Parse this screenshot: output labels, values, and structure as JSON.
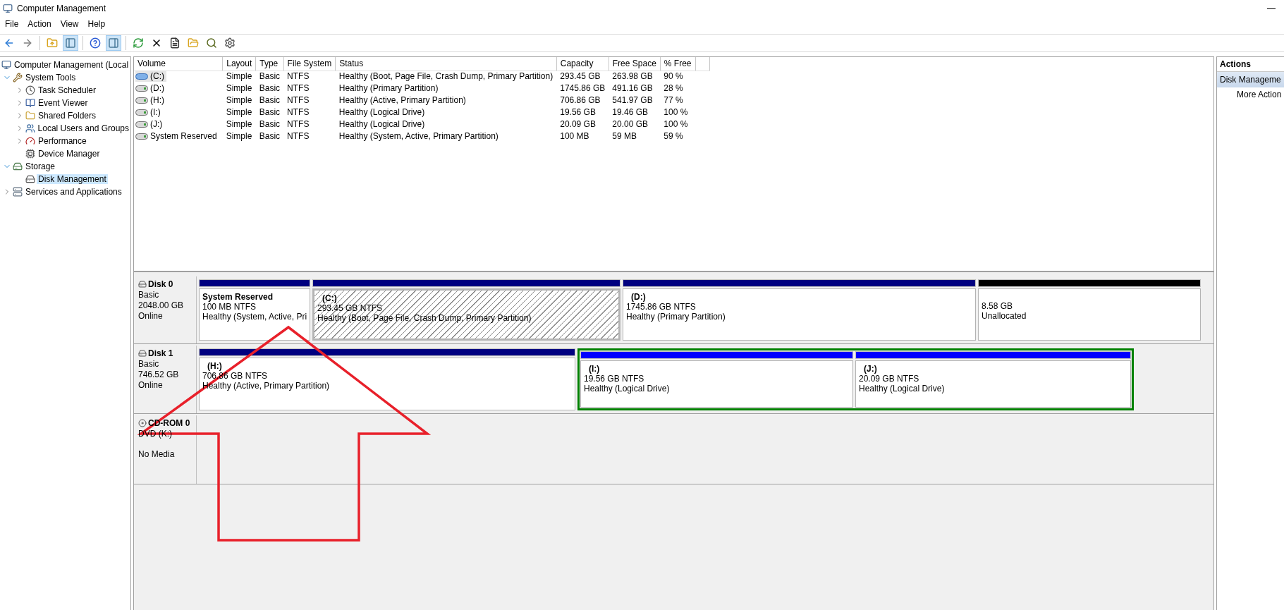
{
  "window": {
    "title": "Computer Management"
  },
  "menu": [
    "File",
    "Action",
    "View",
    "Help"
  ],
  "toolbar": [
    {
      "kind": "back",
      "pressed": false
    },
    {
      "kind": "forward",
      "pressed": false
    },
    {
      "kind": "sep"
    },
    {
      "kind": "up",
      "pressed": false
    },
    {
      "kind": "tree",
      "pressed": true
    },
    {
      "kind": "sep"
    },
    {
      "kind": "help",
      "pressed": false
    },
    {
      "kind": "pane",
      "pressed": true
    },
    {
      "kind": "sep"
    },
    {
      "kind": "refresh",
      "pressed": false
    },
    {
      "kind": "delete",
      "pressed": false
    },
    {
      "kind": "properties",
      "pressed": false
    },
    {
      "kind": "open",
      "pressed": false
    },
    {
      "kind": "find",
      "pressed": false
    },
    {
      "kind": "wizard",
      "pressed": false
    }
  ],
  "tree": [
    {
      "label": "Computer Management (Local",
      "selected": false,
      "children": [
        {
          "label": "System Tools",
          "expanded": true,
          "selected": false,
          "children": [
            {
              "label": "Task Scheduler",
              "expanded": false,
              "selected": false
            },
            {
              "label": "Event Viewer",
              "expanded": false,
              "selected": false
            },
            {
              "label": "Shared Folders",
              "expanded": false,
              "selected": false
            },
            {
              "label": "Local Users and Groups",
              "expanded": false,
              "selected": false
            },
            {
              "label": "Performance",
              "expanded": false,
              "selected": false
            },
            {
              "label": "Device Manager",
              "selected": false
            }
          ]
        },
        {
          "label": "Storage",
          "expanded": true,
          "selected": false,
          "children": [
            {
              "label": "Disk Management",
              "selected": true
            }
          ]
        },
        {
          "label": "Services and Applications",
          "expanded": false,
          "selected": false
        }
      ]
    }
  ],
  "table": {
    "columns": [
      "Volume",
      "Layout",
      "Type",
      "File System",
      "Status",
      "Capacity",
      "Free Space",
      "% Free"
    ],
    "rows": [
      {
        "volume": "(C:)",
        "boot": true,
        "selected": true,
        "layout": "Simple",
        "type": "Basic",
        "fs": "NTFS",
        "status": "Healthy (Boot, Page File, Crash Dump, Primary Partition)",
        "capacity": "293.45 GB",
        "free": "263.98 GB",
        "pct": "90 %"
      },
      {
        "volume": "(D:)",
        "boot": false,
        "selected": false,
        "layout": "Simple",
        "type": "Basic",
        "fs": "NTFS",
        "status": "Healthy (Primary Partition)",
        "capacity": "1745.86 GB",
        "free": "491.16 GB",
        "pct": "28 %"
      },
      {
        "volume": "(H:)",
        "boot": false,
        "selected": false,
        "layout": "Simple",
        "type": "Basic",
        "fs": "NTFS",
        "status": "Healthy (Active, Primary Partition)",
        "capacity": "706.86 GB",
        "free": "541.97 GB",
        "pct": "77 %"
      },
      {
        "volume": "(I:)",
        "boot": false,
        "selected": false,
        "layout": "Simple",
        "type": "Basic",
        "fs": "NTFS",
        "status": "Healthy (Logical Drive)",
        "capacity": "19.56 GB",
        "free": "19.46 GB",
        "pct": "100 %"
      },
      {
        "volume": "(J:)",
        "boot": false,
        "selected": false,
        "layout": "Simple",
        "type": "Basic",
        "fs": "NTFS",
        "status": "Healthy (Logical Drive)",
        "capacity": "20.09 GB",
        "free": "20.00 GB",
        "pct": "100 %"
      },
      {
        "volume": "System Reserved",
        "boot": false,
        "selected": false,
        "layout": "Simple",
        "type": "Basic",
        "fs": "NTFS",
        "status": "Healthy (System, Active, Primary Partition)",
        "capacity": "100 MB",
        "free": "59 MB",
        "pct": "59 %"
      }
    ]
  },
  "disks": [
    {
      "kind": "disk",
      "name": "Disk 0",
      "lines": [
        "Basic",
        "2048.00 GB",
        "Online"
      ],
      "partitions": [
        {
          "kind": "primary",
          "label": "System Reserved",
          "size": "100 MB NTFS",
          "status": "Healthy (System, Active, Pri",
          "selected": false
        },
        {
          "kind": "primary",
          "label": "(C:)",
          "size": "293.45 GB NTFS",
          "status": "Healthy (Boot, Page File, Crash Dump, Primary Partition)",
          "selected": true
        },
        {
          "kind": "primary",
          "label": "(D:)",
          "size": "1745.86 GB NTFS",
          "status": "Healthy (Primary Partition)",
          "selected": false
        },
        {
          "kind": "unallocated",
          "size": "8.58 GB",
          "status": "Unallocated",
          "selected": false
        }
      ]
    },
    {
      "kind": "disk",
      "name": "Disk 1",
      "lines": [
        "Basic",
        "746.52 GB",
        "Online"
      ],
      "partitions": [
        {
          "kind": "primary",
          "label": "(H:)",
          "size": "706.86 GB NTFS",
          "status": "Healthy (Active, Primary Partition)",
          "selected": false
        },
        {
          "kind": "extended",
          "children": [
            {
              "kind": "logical",
              "label": "(I:)",
              "size": "19.56 GB NTFS",
              "status": "Healthy (Logical Drive)",
              "selected": false
            },
            {
              "kind": "logical",
              "label": "(J:)",
              "size": "20.09 GB NTFS",
              "status": "Healthy (Logical Drive)",
              "selected": false
            }
          ]
        }
      ]
    },
    {
      "kind": "cdrom",
      "name": "CD-ROM 0",
      "lines": [
        "DVD (K:)",
        "No Media"
      ]
    }
  ],
  "actions": {
    "title": "Actions",
    "items": [
      {
        "label": "Disk Manageme",
        "kind": "header"
      },
      {
        "label": "More Action",
        "kind": "item"
      }
    ]
  }
}
